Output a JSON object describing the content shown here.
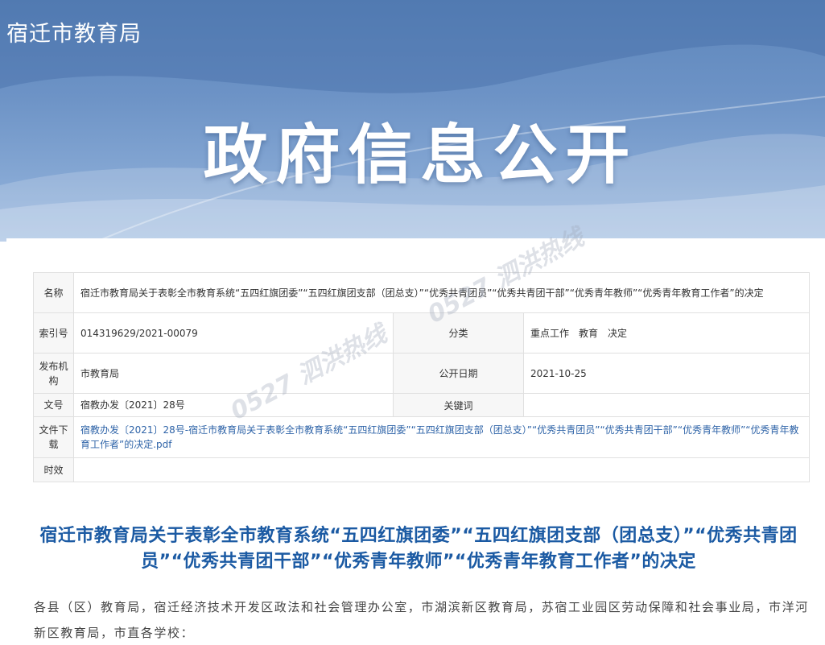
{
  "header": {
    "site_name": "宿迁市教育局",
    "banner_title": "政府信息公开"
  },
  "info_table": {
    "name_label": "名称",
    "name_value": "宿迁市教育局关于表彰全市教育系统“五四红旗团委”“五四红旗团支部（团总支）”“优秀共青团员”“优秀共青团干部”“优秀青年教师”“优秀青年教育工作者”的决定",
    "index_label": "索引号",
    "index_value": "014319629/2021-00079",
    "category_label": "分类",
    "category_value": "重点工作　教育　决定",
    "org_label": "发布机构",
    "org_value": "市教育局",
    "date_label": "公开日期",
    "date_value": "2021-10-25",
    "docno_label": "文号",
    "docno_value": "宿教办发〔2021〕28号",
    "keywords_label": "关键词",
    "keywords_value": "",
    "download_label": "文件下载",
    "download_value": "宿教办发〔2021〕28号-宿迁市教育局关于表彰全市教育系统“五四红旗团委”“五四红旗团支部（团总支）”“优秀共青团员”“优秀共青团干部”“优秀青年教师”“优秀青年教育工作者”的决定.pdf",
    "validity_label": "时效",
    "validity_value": ""
  },
  "article": {
    "title": "宿迁市教育局关于表彰全市教育系统“五四红旗团委”“五四红旗团支部（团总支）”“优秀共青团员”“优秀共青团干部”“优秀青年教师”“优秀青年教育工作者”的决定",
    "greeting": "各县（区）教育局，宿迁经济技术开发区政法和社会管理办公室，市湖滨新区教育局，苏宿工业园区劳动保障和社会事业局，市洋河新区教育局，市直各学校："
  },
  "watermark": {
    "brand": "0527",
    "text": "泗洪热线"
  },
  "colors": {
    "banner_top": "#5d86bb",
    "title_blue": "#1b5aa3",
    "link_blue": "#2f64a8"
  }
}
